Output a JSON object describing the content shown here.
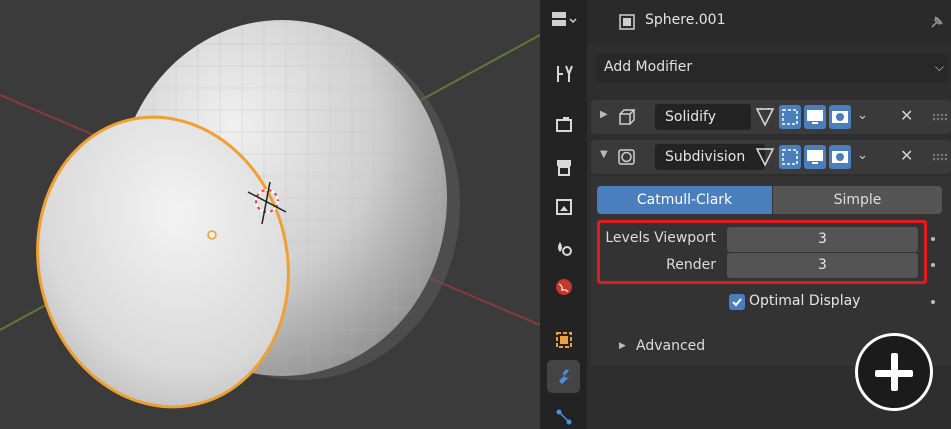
{
  "header": {
    "object_name": "Sphere.001",
    "editor_icon": "properties-editor-icon",
    "object_icon": "mesh-object-icon",
    "pin_icon": "pin-icon"
  },
  "add_modifier": {
    "label": "Add Modifier"
  },
  "modifiers": [
    {
      "name": "Solidify",
      "expanded": false,
      "icon": "solidify-modifier-icon"
    },
    {
      "name": "Subdivision",
      "expanded": true,
      "icon": "subdivision-modifier-icon"
    }
  ],
  "subdivision": {
    "algorithms": [
      "Catmull-Clark",
      "Simple"
    ],
    "selected_algorithm": "Catmull-Clark",
    "levels_viewport_label": "Levels Viewport",
    "levels_viewport_value": "3",
    "render_label": "Render",
    "render_value": "3",
    "optimal_display_label": "Optimal Display",
    "optimal_display_checked": true,
    "advanced_label": "Advanced"
  },
  "tabs": [
    "tool",
    "render",
    "output",
    "view-layer",
    "scene",
    "world",
    "object",
    "modifiers",
    "particles"
  ],
  "active_tab": "modifiers",
  "colors": {
    "accent_blue": "#4a7ebd",
    "highlight_red": "#e01b1b",
    "selection_orange": "#f0a030"
  },
  "overlay": {
    "zoom_icon": "zoom-in-plus-icon"
  }
}
